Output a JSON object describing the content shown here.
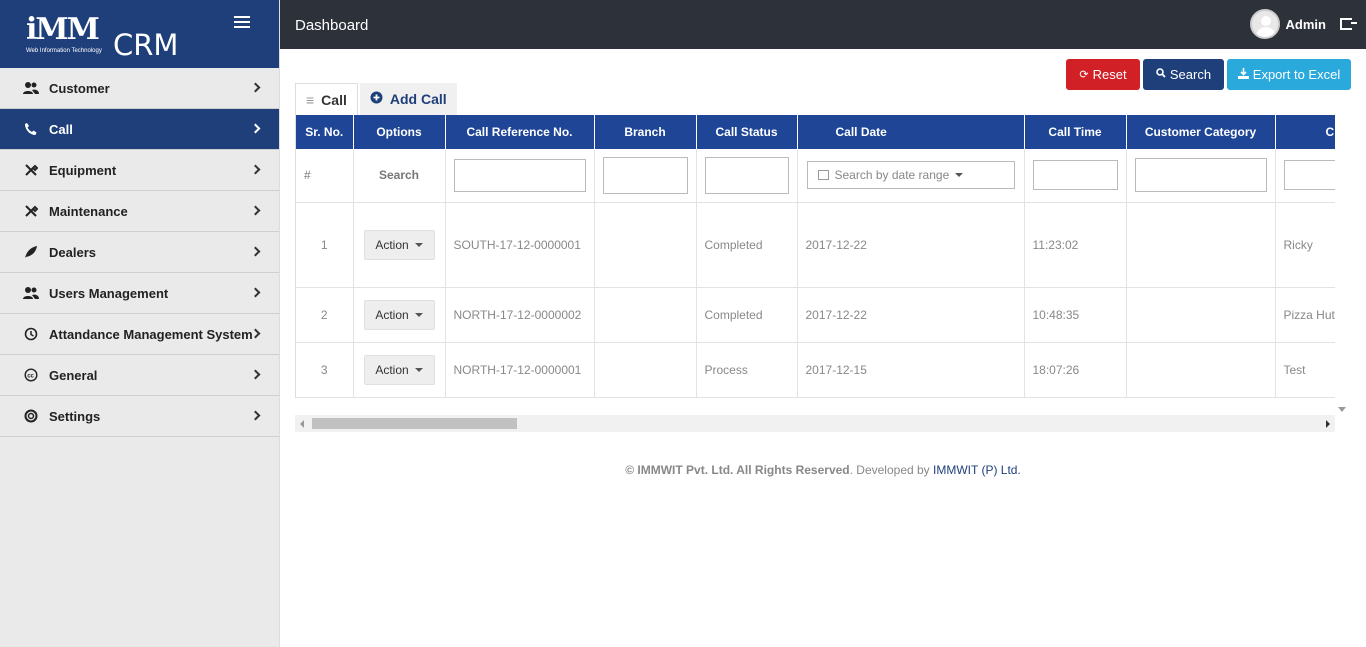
{
  "brand": {
    "logo_text": "iMM",
    "logo_sub": "Web Information Technology",
    "app_name": "CRM"
  },
  "sidebar": {
    "items": [
      {
        "label": "Customer",
        "icon": "users-icon"
      },
      {
        "label": "Call",
        "icon": "phone-icon"
      },
      {
        "label": "Equipment",
        "icon": "tools-icon"
      },
      {
        "label": "Maintenance",
        "icon": "tools-icon"
      },
      {
        "label": "Dealers",
        "icon": "leaf-icon"
      },
      {
        "label": "Users Management",
        "icon": "users-icon"
      },
      {
        "label": "Attandance Management System",
        "icon": "history-icon"
      },
      {
        "label": "General",
        "icon": "cc-icon"
      },
      {
        "label": "Settings",
        "icon": "life-ring-icon"
      }
    ]
  },
  "header": {
    "title": "Dashboard",
    "user_name": "Admin"
  },
  "toolbar": {
    "reset_label": "Reset",
    "search_label": "Search",
    "export_label": "Export to Excel"
  },
  "tabs": [
    {
      "label": "Call"
    },
    {
      "label": "Add Call"
    }
  ],
  "table": {
    "columns": [
      "Sr. No.",
      "Options",
      "Call Reference No.",
      "Branch",
      "Call Status",
      "Call Date",
      "Call Time",
      "Customer Category",
      "C"
    ],
    "filter": {
      "hash": "#",
      "search_label": "Search",
      "date_placeholder": "Search by date range"
    },
    "action_label": "Action",
    "rows": [
      {
        "sr": "1",
        "ref": "SOUTH-17-12-0000001",
        "branch": "",
        "status": "Completed",
        "date": "2017-12-22",
        "time": "11:23:02",
        "category": "",
        "customer": "Ricky"
      },
      {
        "sr": "2",
        "ref": "NORTH-17-12-0000002",
        "branch": "",
        "status": "Completed",
        "date": "2017-12-22",
        "time": "10:48:35",
        "category": "",
        "customer": "Pizza Hut"
      },
      {
        "sr": "3",
        "ref": "NORTH-17-12-0000001",
        "branch": "",
        "status": "Process",
        "date": "2017-12-15",
        "time": "18:07:26",
        "category": "",
        "customer": "Test"
      }
    ]
  },
  "footer": {
    "copyright": "© IMMWIT Pvt. Ltd. All Rights Reserved",
    "developed_by": ". Developed by ",
    "company_link": "IMMWIT (P) Ltd."
  },
  "colors": {
    "brand_blue": "#1f3f7a",
    "header_dark": "#2d313a",
    "table_header": "#1f4596",
    "reset_red": "#d22027",
    "export_cyan": "#2aa9dd"
  }
}
